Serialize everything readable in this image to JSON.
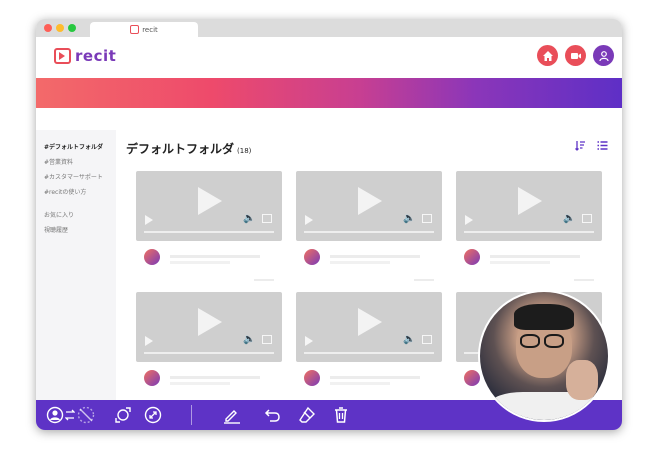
{
  "tab": {
    "title": "recit"
  },
  "brand": {
    "name": "recit"
  },
  "sidebar": {
    "items": [
      {
        "label": "#デフォルトフォルダ",
        "active": true
      },
      {
        "label": "#営業資料"
      },
      {
        "label": "#カスタマーサポート"
      },
      {
        "label": "#recitの使い方"
      }
    ],
    "items2": [
      {
        "label": "お気に入り"
      },
      {
        "label": "視聴履歴"
      }
    ]
  },
  "main": {
    "title": "デフォルトフォルダ",
    "count": "(18)"
  },
  "colors": {
    "accent": "#5e33c6",
    "brand": "#e94e59",
    "toolbar": "#5e33c6"
  }
}
